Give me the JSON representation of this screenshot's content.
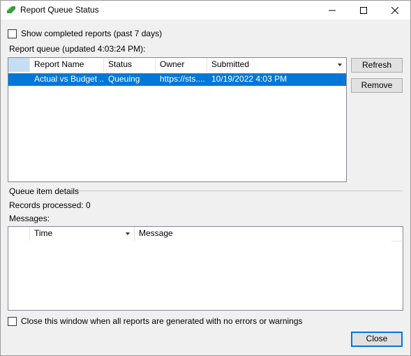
{
  "window": {
    "title": "Report Queue Status",
    "brand_color": "#3a9a3a"
  },
  "options": {
    "show_completed_label": "Show completed reports (past 7 days)",
    "show_completed_checked": false
  },
  "queue": {
    "label": "Report queue (updated 4:03:24 PM):",
    "columns": [
      "",
      "Report Name",
      "Status",
      "Owner",
      "Submitted"
    ],
    "rows": [
      {
        "report_name": "Actual vs Budget ...",
        "status": "Queuing",
        "owner": "https://sts....",
        "submitted": "10/19/2022 4:03 PM",
        "selected": true
      }
    ]
  },
  "buttons": {
    "refresh": "Refresh",
    "remove": "Remove",
    "close": "Close"
  },
  "details": {
    "section_label": "Queue item details",
    "records_processed": "Records processed: 0",
    "messages_label": "Messages:",
    "columns": [
      "",
      "Time",
      "Message"
    ]
  },
  "footer": {
    "close_when_done_label": "Close this window when all reports are generated with no errors or warnings",
    "close_when_done_checked": false
  },
  "colors": {
    "selection": "#0078d7",
    "header_highlight": "#c6def4"
  }
}
